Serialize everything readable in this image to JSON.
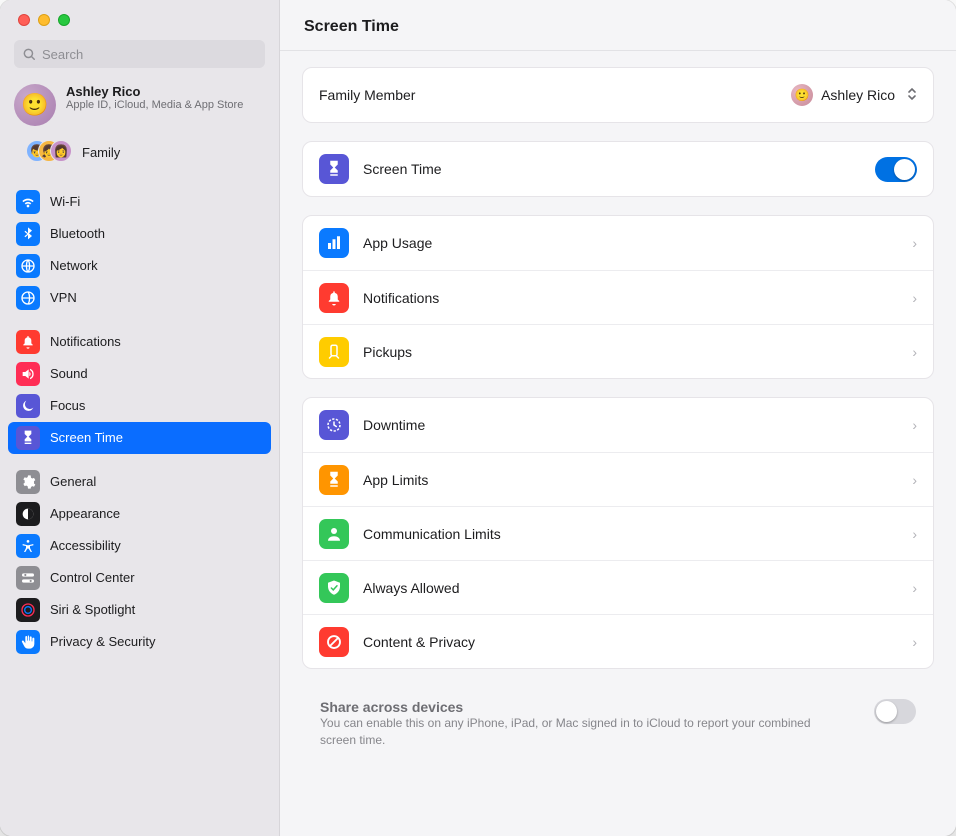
{
  "window": {
    "title": "Screen Time"
  },
  "search": {
    "placeholder": "Search"
  },
  "account": {
    "name": "Ashley Rico",
    "subtitle": "Apple ID, iCloud, Media & App Store",
    "family_label": "Family"
  },
  "sidebar": {
    "g1": [
      {
        "label": "Wi-Fi",
        "icon": "wifi",
        "bg": "#0a7aff"
      },
      {
        "label": "Bluetooth",
        "icon": "bluetooth",
        "bg": "#0a7aff"
      },
      {
        "label": "Network",
        "icon": "network",
        "bg": "#0a7aff"
      },
      {
        "label": "VPN",
        "icon": "vpn",
        "bg": "#0a7aff"
      }
    ],
    "g2": [
      {
        "label": "Notifications",
        "icon": "bell",
        "bg": "#ff3b30"
      },
      {
        "label": "Sound",
        "icon": "sound",
        "bg": "#ff2d55"
      },
      {
        "label": "Focus",
        "icon": "moon",
        "bg": "#5856d6"
      },
      {
        "label": "Screen Time",
        "icon": "hourglass",
        "bg": "#5856d6",
        "selected": true
      }
    ],
    "g3": [
      {
        "label": "General",
        "icon": "gear",
        "bg": "#8e8e93"
      },
      {
        "label": "Appearance",
        "icon": "appearance",
        "bg": "#1c1c1e"
      },
      {
        "label": "Accessibility",
        "icon": "accessibility",
        "bg": "#0a7aff"
      },
      {
        "label": "Control Center",
        "icon": "switches",
        "bg": "#8e8e93"
      },
      {
        "label": "Siri & Spotlight",
        "icon": "siri",
        "bg": "#1c1c1e"
      },
      {
        "label": "Privacy & Security",
        "icon": "hand",
        "bg": "#0a7aff"
      }
    ]
  },
  "family_member": {
    "label": "Family Member",
    "value": "Ashley Rico"
  },
  "screen_time_toggle": {
    "label": "Screen Time",
    "on": true
  },
  "section_usage": [
    {
      "label": "App Usage",
      "icon": "chart",
      "bg": "#0a7aff"
    },
    {
      "label": "Notifications",
      "icon": "bell",
      "bg": "#ff3b30"
    },
    {
      "label": "Pickups",
      "icon": "pickups",
      "bg": "#ffcc00"
    }
  ],
  "section_limits": [
    {
      "label": "Downtime",
      "icon": "clock",
      "bg": "#5856d6"
    },
    {
      "label": "App Limits",
      "icon": "hourglass",
      "bg": "#ff9500"
    },
    {
      "label": "Communication Limits",
      "icon": "person",
      "bg": "#34c759"
    },
    {
      "label": "Always Allowed",
      "icon": "shield-check",
      "bg": "#34c759"
    },
    {
      "label": "Content & Privacy",
      "icon": "nosign",
      "bg": "#ff3b30"
    }
  ],
  "share": {
    "title": "Share across devices",
    "desc": "You can enable this on any iPhone, iPad, or Mac signed in to iCloud to report your combined screen time.",
    "on": false
  }
}
